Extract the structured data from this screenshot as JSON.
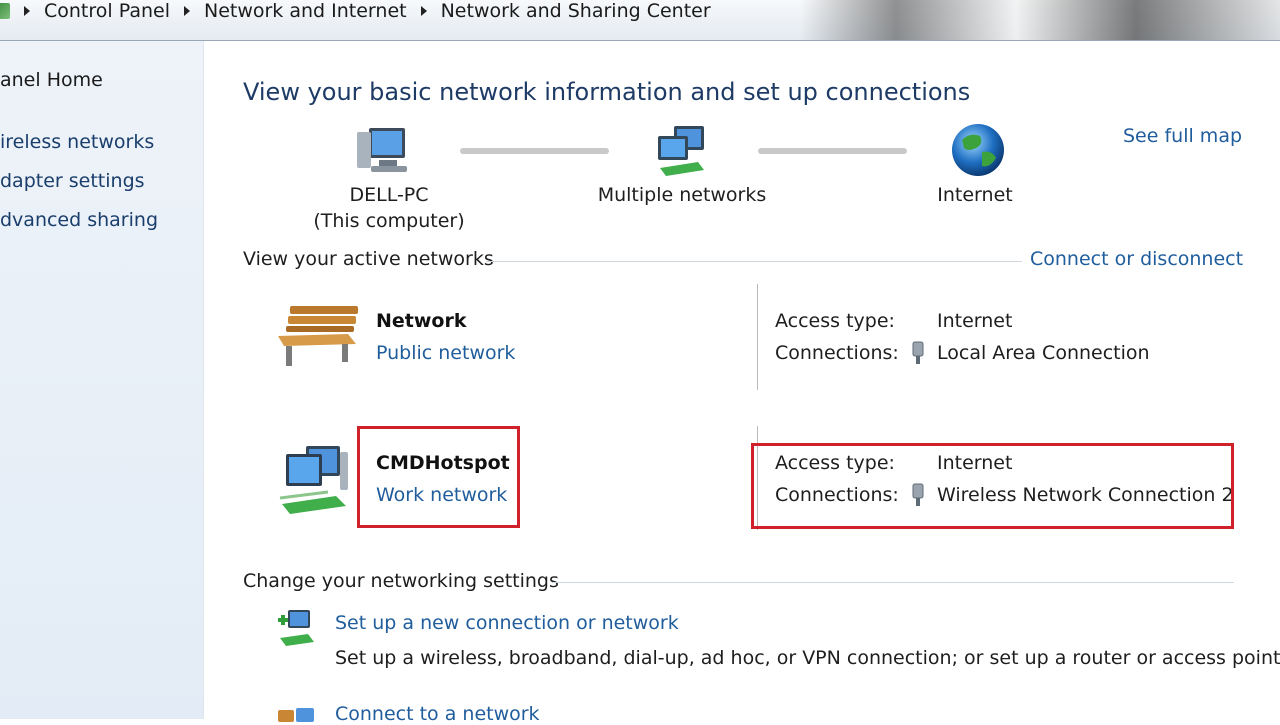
{
  "breadcrumb": {
    "items": [
      "Control Panel",
      "Network and Internet",
      "Network and Sharing Center"
    ]
  },
  "left_pane": {
    "home": "anel Home",
    "links": [
      "ireless networks",
      "dapter settings",
      "dvanced sharing"
    ]
  },
  "main": {
    "title": "View your basic network information and set up connections",
    "map": {
      "computer_name": "DELL-PC",
      "computer_sub": "(This computer)",
      "middle": "Multiple networks",
      "internet": "Internet",
      "see_full_map": "See full map"
    },
    "active_networks": {
      "heading": "View your active networks",
      "connect_link": "Connect or disconnect",
      "networks": [
        {
          "name": "Network",
          "type": "Public network",
          "access_label": "Access type:",
          "access_value": "Internet",
          "connections_label": "Connections:",
          "connection": "Local Area Connection"
        },
        {
          "name": "CMDHotspot",
          "type": "Work network",
          "access_label": "Access type:",
          "access_value": "Internet",
          "connections_label": "Connections:",
          "connection": "Wireless Network Connection 2"
        }
      ]
    },
    "change_settings": {
      "heading": "Change your networking settings",
      "tasks": [
        {
          "title": "Set up a new connection or network",
          "description": "Set up a wireless, broadband, dial-up, ad hoc, or VPN connection; or set up a router or access point."
        },
        {
          "title": "Connect to a network"
        }
      ]
    }
  },
  "colors": {
    "link": "#1f5d9c",
    "title": "#1e3b66",
    "highlight": "#d0202a",
    "left_pane_bg": "#e8eff7"
  }
}
